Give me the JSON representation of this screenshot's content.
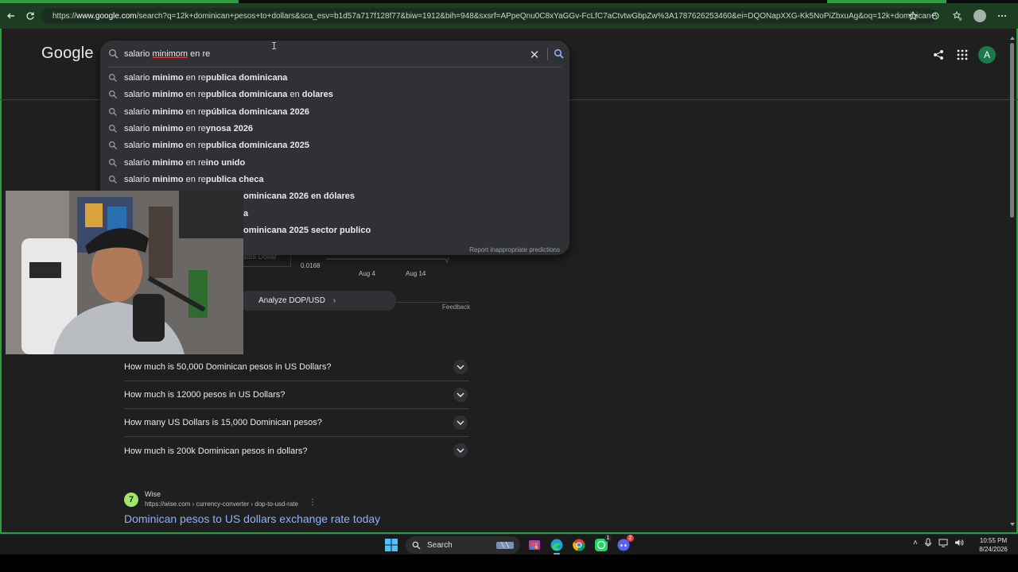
{
  "browser": {
    "url_prefix": "https://",
    "url_host": "www.google.com",
    "url_rest": "/search?q=12k+dominican+pesos+to+dollars&sca_esv=b1d57a717f128f77&biw=1912&bih=948&sxsrf=APpeQnu0C8xYaGGv-FcLfC7aCtvtwGbpZw%3A1787626253460&ei=DQONapXXG-Kk5NoPiZbxuAg&oq=12k+dominican+&gs_lp=E...",
    "accent_color": "#2e9d3e"
  },
  "google": {
    "logo": "Google",
    "query_typed_1": "salario ",
    "query_typed_misspelled": "minimom",
    "query_typed_2": " en re",
    "avatar_letter": "A",
    "report_text": "Report inappropriate predictions"
  },
  "suggestions": [
    {
      "plain": "salario ",
      "bold1": "minimo",
      "mid": " en re",
      "bold2": "publica dominicana",
      "tail": "",
      "tail_bold": ""
    },
    {
      "plain": "salario ",
      "bold1": "minimo",
      "mid": " en re",
      "bold2": "publica dominicana",
      "tail": " en ",
      "tail_bold": "dolares"
    },
    {
      "plain": "salario ",
      "bold1": "minimo",
      "mid": " en re",
      "bold2": "pública dominicana 2026",
      "tail": "",
      "tail_bold": ""
    },
    {
      "plain": "salario ",
      "bold1": "minimo",
      "mid": " en re",
      "bold2": "ynosa 2026",
      "tail": "",
      "tail_bold": ""
    },
    {
      "plain": "salario ",
      "bold1": "minimo",
      "mid": " en re",
      "bold2": "publica dominicana 2025",
      "tail": "",
      "tail_bold": ""
    },
    {
      "plain": "salario ",
      "bold1": "minimo",
      "mid": " en re",
      "bold2": "ino unido",
      "tail": "",
      "tail_bold": ""
    },
    {
      "plain": "salario ",
      "bold1": "minimo",
      "mid": " en re",
      "bold2": "publica checa",
      "tail": "",
      "tail_bold": ""
    },
    {
      "plain": "",
      "bold1": "",
      "mid": "",
      "bold2": "ominicana 2026 en dólares",
      "tail": "",
      "tail_bold": ""
    },
    {
      "plain": "",
      "bold1": "",
      "mid": "",
      "bold2": "a",
      "tail": "",
      "tail_bold": ""
    },
    {
      "plain": "",
      "bold1": "",
      "mid": "",
      "bold2": "ominicana 2025 sector publico",
      "tail": "",
      "tail_bold": ""
    }
  ],
  "chart_fragment": {
    "unit_label": "ates Dollar",
    "value": "0.0168",
    "tick1": "Aug 4",
    "tick2": "Aug 14"
  },
  "analyze_label": "Analyze DOP/USD",
  "feedback_label": "Feedback",
  "questions": [
    "How much is 50,000 Dominican pesos in US Dollars?",
    "How much is 12000 pesos in US Dollars?",
    "How many US Dollars is 15,000 Dominican pesos?",
    "How much is 200k Dominican pesos in dollars?"
  ],
  "result": {
    "site_name": "Wise",
    "cite": "https://wise.com › currency-converter › dop-to-usd-rate",
    "title": "Dominican pesos to US dollars exchange rate today"
  },
  "taskbar": {
    "search_label": "Search",
    "time": "10:55 PM",
    "date": "8/24/2026",
    "whatsapp_badge": "1",
    "discord_badge": "2"
  }
}
